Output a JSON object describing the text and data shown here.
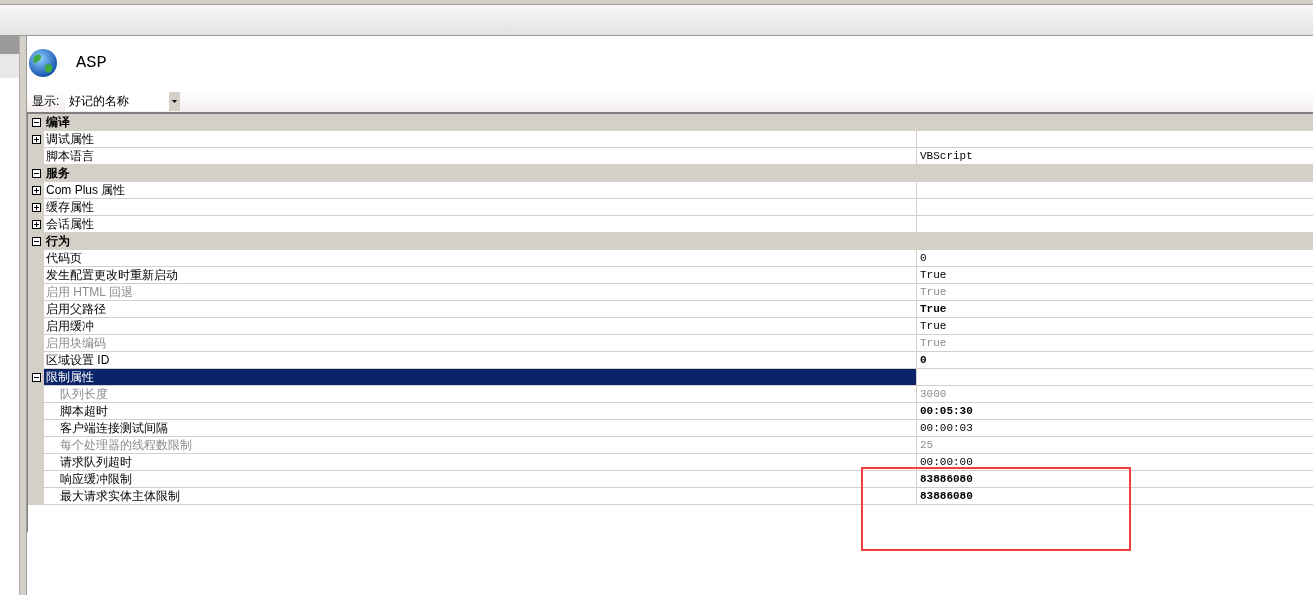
{
  "page": {
    "title": "ASP"
  },
  "display": {
    "label": "显示:",
    "value": "好记的名称"
  },
  "categories": [
    {
      "label": "编译",
      "expanded": true,
      "items": [
        {
          "name": "调试属性",
          "expanded": false,
          "disabled": false,
          "selected": false
        },
        {
          "name": "脚本语言",
          "value": "VBScript",
          "disabled": false,
          "bold": false,
          "selected": false
        }
      ]
    },
    {
      "label": "服务",
      "expanded": true,
      "items": [
        {
          "name": "Com Plus 属性",
          "expanded": false,
          "disabled": false,
          "selected": false
        },
        {
          "name": "缓存属性",
          "expanded": false,
          "disabled": false,
          "selected": false
        },
        {
          "name": "会话属性",
          "expanded": false,
          "disabled": false,
          "selected": false
        }
      ]
    },
    {
      "label": "行为",
      "expanded": true,
      "items": [
        {
          "name": "代码页",
          "value": "0",
          "disabled": false,
          "bold": false,
          "selected": false
        },
        {
          "name": "发生配置更改时重新启动",
          "value": "True",
          "disabled": false,
          "bold": false,
          "selected": false
        },
        {
          "name": "启用 HTML 回退",
          "value": "True",
          "disabled": true,
          "bold": false,
          "selected": false
        },
        {
          "name": "启用父路径",
          "value": "True",
          "disabled": false,
          "bold": true,
          "selected": false
        },
        {
          "name": "启用缓冲",
          "value": "True",
          "disabled": false,
          "bold": false,
          "selected": false
        },
        {
          "name": "启用块编码",
          "value": "True",
          "disabled": true,
          "bold": false,
          "selected": false
        },
        {
          "name": "区域设置 ID",
          "value": "0",
          "disabled": false,
          "bold": true,
          "selected": false
        },
        {
          "name": "限制属性",
          "expanded": true,
          "disabled": false,
          "selected": true,
          "children": [
            {
              "name": "队列长度",
              "value": "3000",
              "disabled": true,
              "bold": false,
              "selected": false
            },
            {
              "name": "脚本超时",
              "value": "00:05:30",
              "disabled": false,
              "bold": true,
              "selected": false
            },
            {
              "name": "客户端连接测试间隔",
              "value": "00:00:03",
              "disabled": false,
              "bold": false,
              "selected": false
            },
            {
              "name": "每个处理器的线程数限制",
              "value": "25",
              "disabled": true,
              "bold": false,
              "selected": false
            },
            {
              "name": "请求队列超时",
              "value": "00:00:00",
              "disabled": false,
              "bold": false,
              "selected": false
            },
            {
              "name": "响应缓冲限制",
              "value": "83886080",
              "disabled": false,
              "bold": true,
              "selected": false
            },
            {
              "name": "最大请求实体主体限制",
              "value": "83886080",
              "disabled": false,
              "bold": true,
              "selected": false
            }
          ]
        }
      ]
    }
  ]
}
